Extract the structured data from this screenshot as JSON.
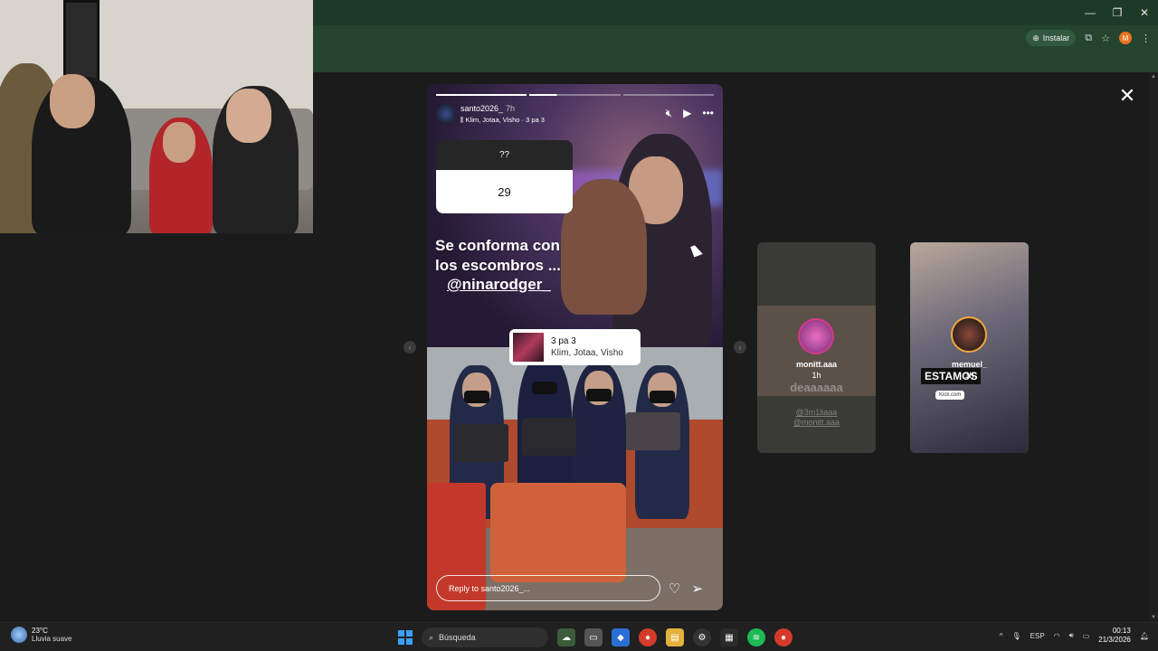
{
  "browser": {
    "install_label": "Instalar",
    "window_controls": [
      "—",
      "❐",
      "✕"
    ]
  },
  "story": {
    "username": "santo2026_",
    "time": "7h",
    "music_line": "Klim, Jotaa, Visho · 3 pa 3",
    "question": "??",
    "answer": "29",
    "caption": "Se conforma con los escombros ...",
    "mention": "@ninarodger_",
    "music_title": "3 pa 3",
    "music_artist": "Klim, Jotaa, Visho",
    "reply_placeholder": "Reply to santo2026_...",
    "progress_segments": 3,
    "active_segment": 2,
    "icons": [
      "mute-icon",
      "play-icon",
      "more-icon",
      "heart-icon",
      "send-icon",
      "close-icon"
    ]
  },
  "previews": [
    {
      "name": "monitt.aaa",
      "time": "1h",
      "faint_text": "deaaaaaa",
      "mentions": [
        "@3m1liaaa",
        "@monitt.aaa"
      ]
    },
    {
      "name": "memuel_",
      "time": "1h",
      "sticker_text": "ESTAMOS",
      "link_text": "Kick.com"
    }
  ],
  "taskbar": {
    "temp": "23°C",
    "weather": "Lluvia suave",
    "search": "Búsqueda",
    "lang": "ESP",
    "time": "00:13",
    "date": "21/3/2026"
  }
}
